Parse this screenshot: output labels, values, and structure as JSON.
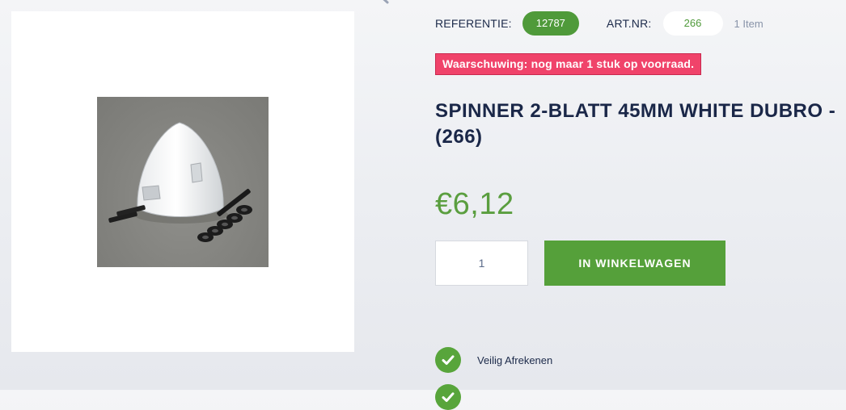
{
  "meta": {
    "reference_label": "REFERENTIE:",
    "reference_value": "12787",
    "art_label": "ART.NR:",
    "art_value": "266",
    "item_count": "1 Item"
  },
  "stock_warning": "Waarschuwing: nog maar 1 stuk op voorraad.",
  "product": {
    "title": "SPINNER 2-BLATT 45MM WHITE DUBRO - (266)",
    "price": "€6,12",
    "image_icon": "product-photo"
  },
  "purchase": {
    "quantity": "1",
    "add_to_cart_label": "IN WINKELWAGEN"
  },
  "usps": [
    {
      "icon": "check-icon",
      "label": "Veilig Afrekenen"
    },
    {
      "icon": "check-icon",
      "label": ""
    }
  ],
  "colors": {
    "accent_green": "#55a03a",
    "warning_red": "#f0436a",
    "title_navy": "#1a2748",
    "price_green": "#5a9e3f"
  }
}
